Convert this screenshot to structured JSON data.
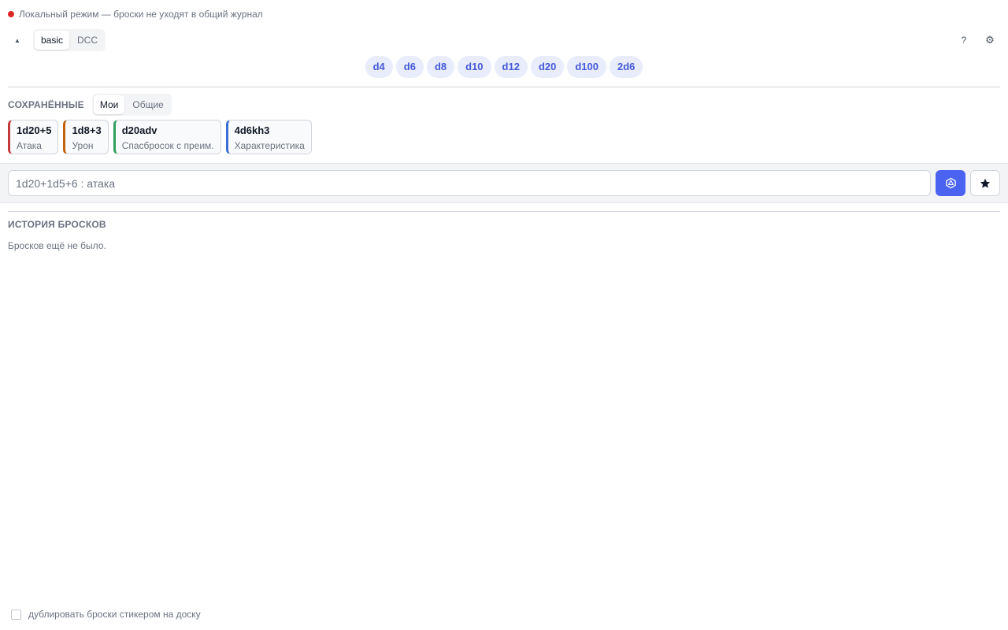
{
  "status": {
    "text": "Локальный режим — броски не уходят в общий журнал",
    "color": "#dc2626"
  },
  "toolbar": {
    "collapse_icon": "▲",
    "modes": [
      {
        "label": "basic",
        "active": true
      },
      {
        "label": "DCC",
        "active": false
      }
    ],
    "help_label": "?",
    "settings_icon": "⚙"
  },
  "dice": [
    "d4",
    "d6",
    "d8",
    "d10",
    "d12",
    "d20",
    "d100",
    "2d6"
  ],
  "saved": {
    "title": "СОХРАНЁННЫЕ",
    "tabs": [
      {
        "label": "Мои",
        "active": true
      },
      {
        "label": "Общие",
        "active": false
      }
    ],
    "items": [
      {
        "formula": "1d20+5",
        "label": "Атака",
        "color": "#c53b3b"
      },
      {
        "formula": "1d8+3",
        "label": "Урон",
        "color": "#c2620f"
      },
      {
        "formula": "d20adv",
        "label": "Спасбросок с преим.",
        "color": "#2f9e5b"
      },
      {
        "formula": "4d6kh3",
        "label": "Характеристика",
        "color": "#3b6fd6"
      }
    ]
  },
  "input": {
    "placeholder": "1d20+1d5+6 : атака",
    "value": ""
  },
  "history": {
    "title": "ИСТОРИЯ БРОСКОВ",
    "empty_text": "Бросков ещё не было."
  },
  "footer": {
    "checkbox_label": "дублировать броски стикером на доску",
    "checked": false
  },
  "colors": {
    "accent": "#4a63f0",
    "dice_bg": "#e8ecfb",
    "dice_text": "#4459d6"
  }
}
